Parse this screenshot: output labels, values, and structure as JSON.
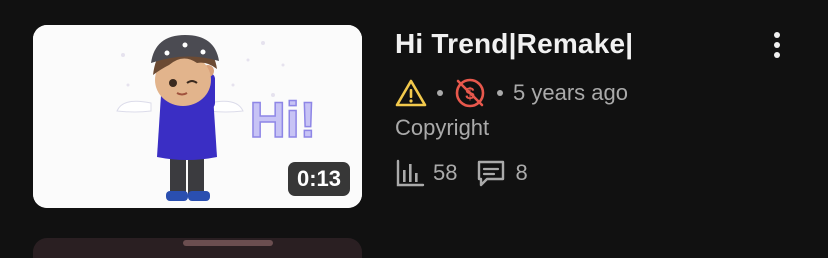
{
  "video": {
    "title": "Hi Trend|Remake|",
    "duration": "0:13",
    "age": "5 years ago",
    "status_label": "Copyright",
    "views": "58",
    "comments": "8",
    "thumbnail_text": "Hi!",
    "icons": {
      "warning": "warning-icon",
      "demonetized": "demonetized-icon",
      "views": "analytics-bars-icon",
      "comments": "comment-icon",
      "more": "more-vertical-icon"
    },
    "colors": {
      "warning": "#f2c94c",
      "demonetized": "#e8584c",
      "secondary_text": "#aaaaaa",
      "background": "#111111"
    }
  }
}
